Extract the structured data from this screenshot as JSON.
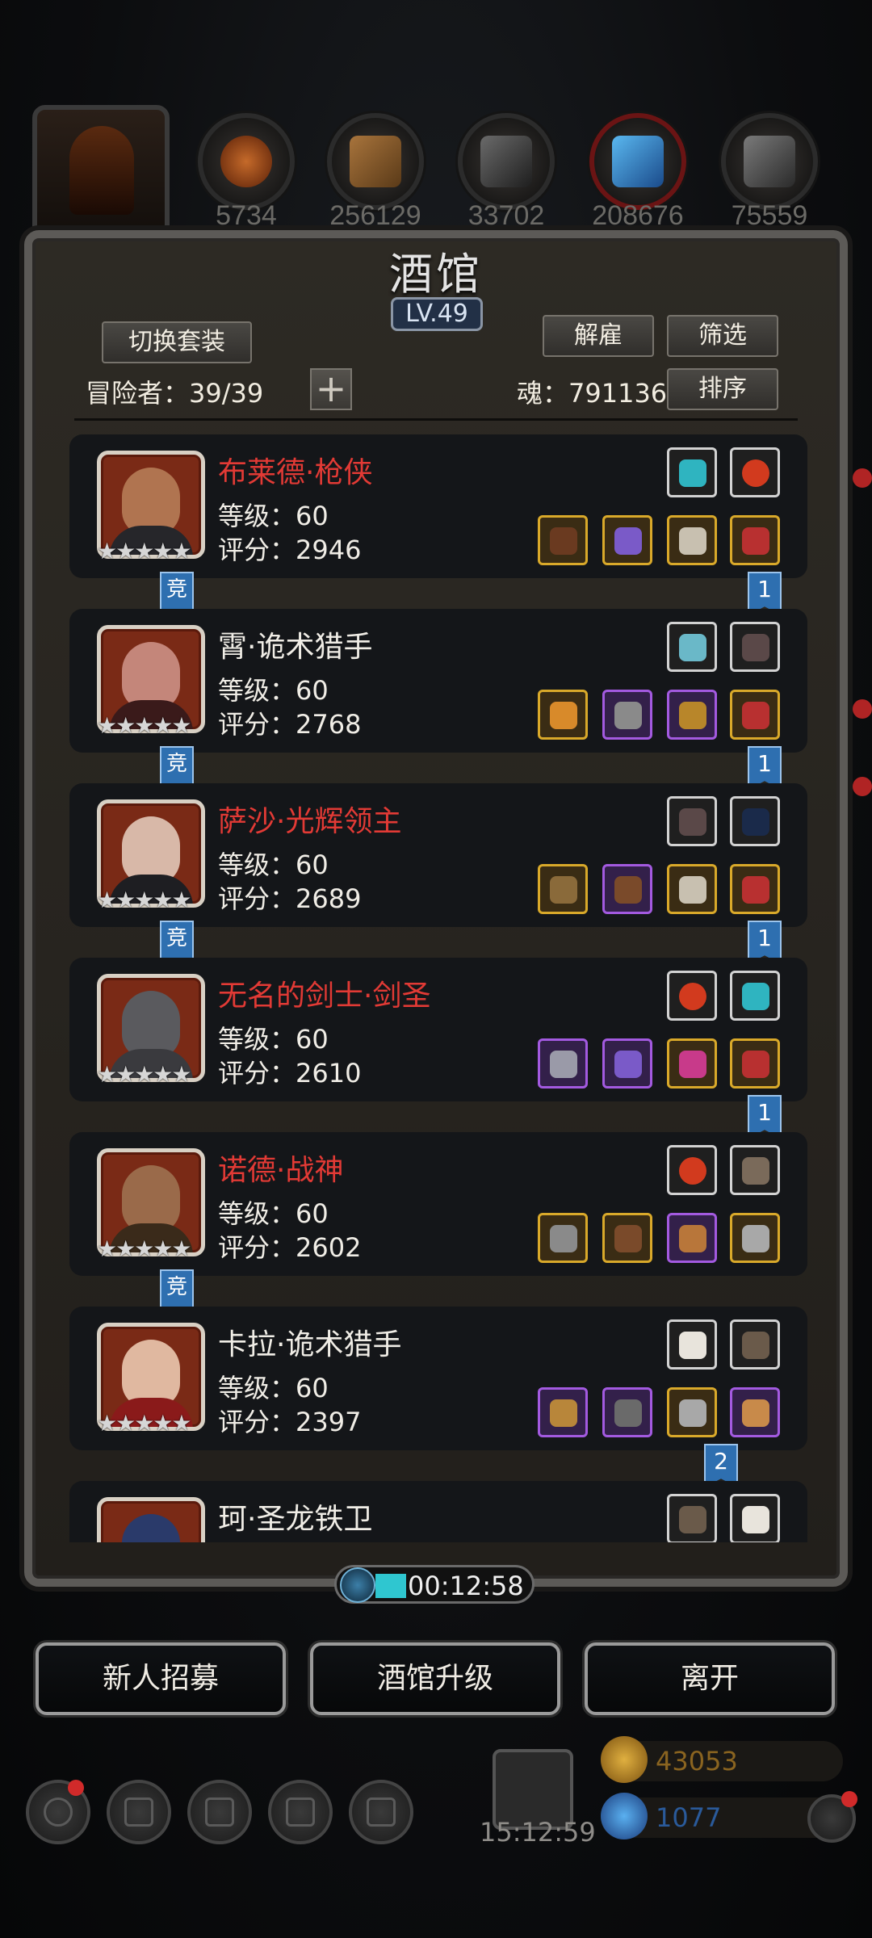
{
  "resources": {
    "values": [
      "5734",
      "256129",
      "33702",
      "208676",
      "75559"
    ]
  },
  "tavern": {
    "title": "酒馆",
    "level": "LV.49",
    "switch_outfit": "切换套装",
    "dismiss": "解雇",
    "filter": "筛选",
    "sort": "排序",
    "adventurers_label": "冒险者：39/39",
    "soul_label": "魂：791136",
    "plus": "+"
  },
  "heroes": [
    {
      "name": "布莱德·枪侠",
      "name_color": "red",
      "level": "等级：60",
      "score": "评分：2946",
      "stars": "★★★★★",
      "tag_jing": "竞",
      "tag_num": "1"
    },
    {
      "name": "霄·诡术猎手",
      "name_color": "white",
      "level": "等级：60",
      "score": "评分：2768",
      "stars": "★★★★★",
      "tag_jing": "竞",
      "tag_num": "1"
    },
    {
      "name": "萨沙·光辉领主",
      "name_color": "red",
      "level": "等级：60",
      "score": "评分：2689",
      "stars": "★★★★★",
      "tag_jing": "竞",
      "tag_num": "1"
    },
    {
      "name": "无名的剑士·剑圣",
      "name_color": "red",
      "level": "等级：60",
      "score": "评分：2610",
      "stars": "★★★★★",
      "tag_jing": "",
      "tag_num": "1"
    },
    {
      "name": "诺德·战神",
      "name_color": "red",
      "level": "等级：60",
      "score": "评分：2602",
      "stars": "★★★★★",
      "tag_jing": "竞",
      "tag_num": ""
    },
    {
      "name": "卡拉·诡术猎手",
      "name_color": "white",
      "level": "等级：60",
      "score": "评分：2397",
      "stars": "★★★★★",
      "tag_jing": "",
      "tag_num": "2"
    },
    {
      "name": "珂·圣龙铁卫",
      "name_color": "white",
      "level": "",
      "score": "",
      "stars": "",
      "tag_jing": "",
      "tag_num": ""
    }
  ],
  "timer": "00:12:58",
  "actions": {
    "recruit": "新人招募",
    "upgrade": "酒馆升级",
    "leave": "离开"
  },
  "footer": {
    "gift_timer": "15:12:59",
    "gold": "43053",
    "gems": "1077"
  },
  "colors": {
    "name_red": "#e23a35",
    "tag_blue": "#2e6fb0",
    "equip_gold": "#d9a92a",
    "equip_purple": "#a35ae0"
  }
}
